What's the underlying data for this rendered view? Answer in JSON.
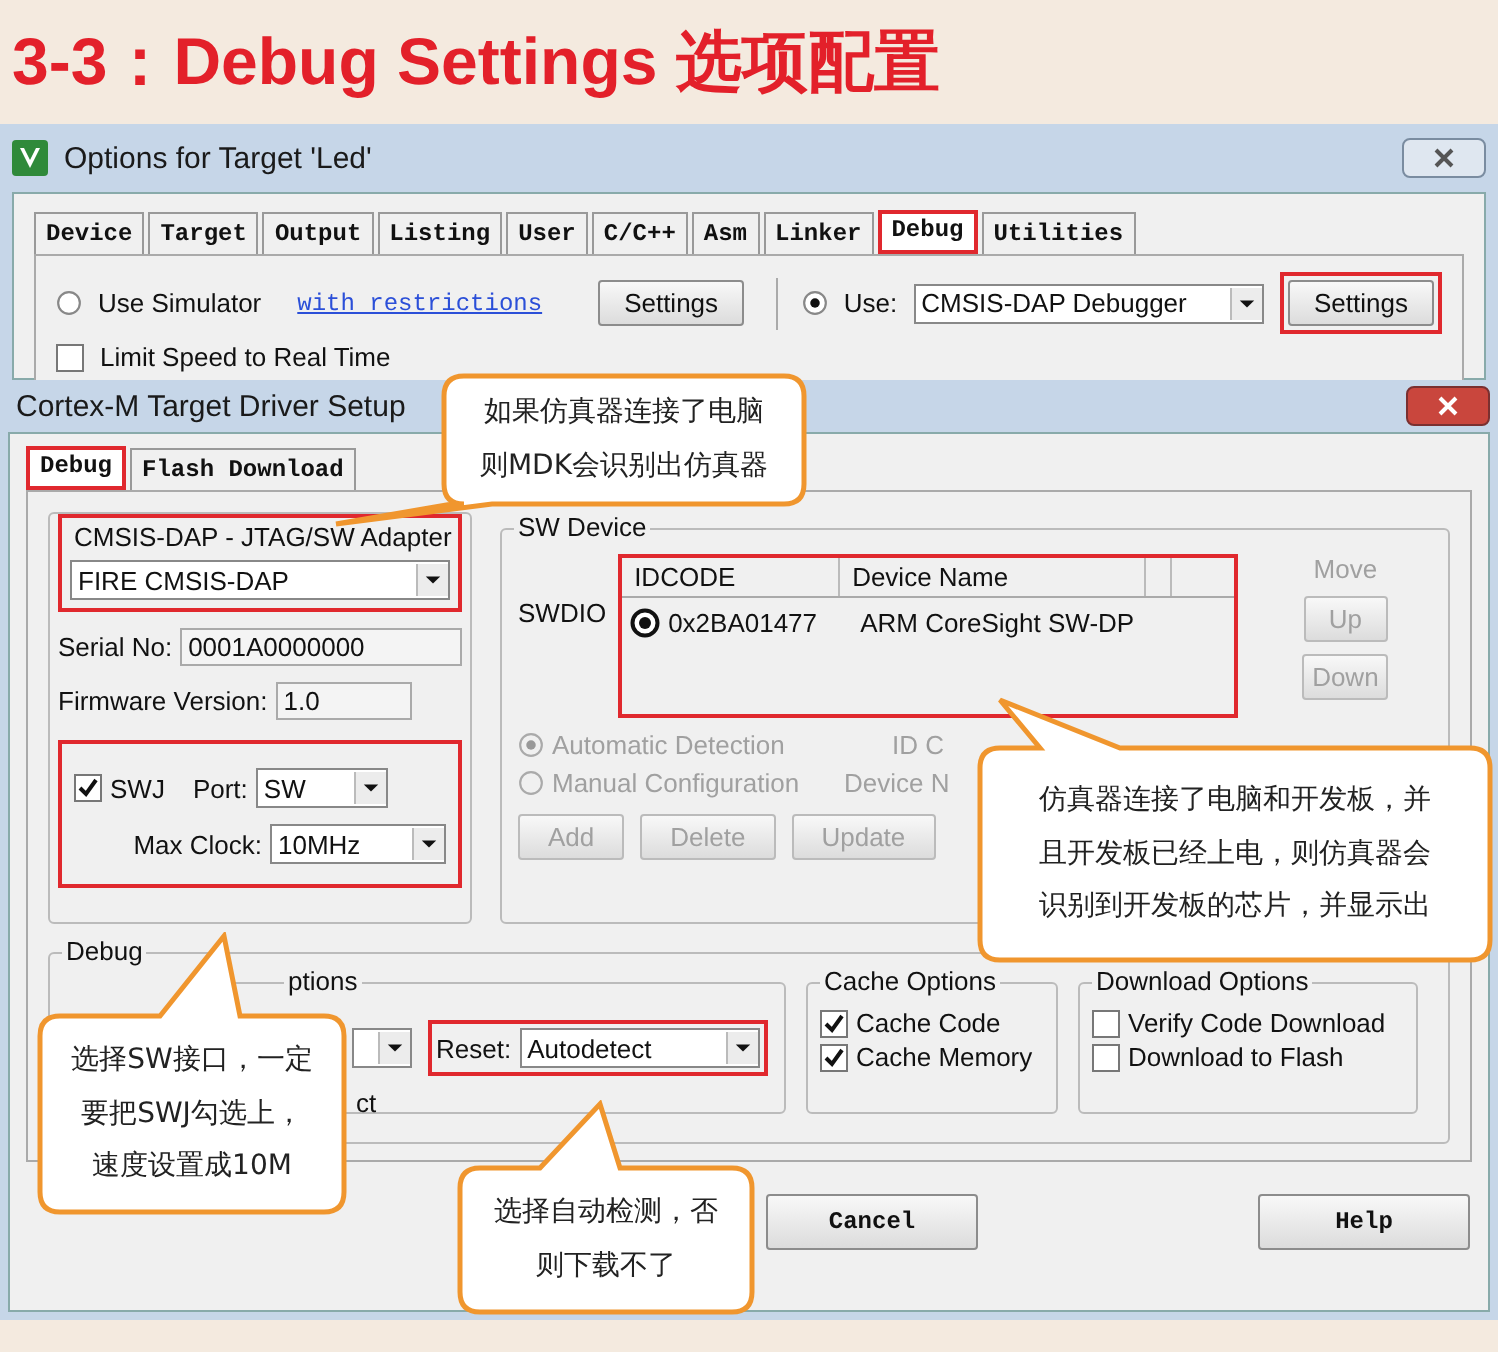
{
  "page_title": "3-3：Debug Settings 选项配置",
  "background_window": {
    "title": "Options for Target 'Led'",
    "tabs": [
      {
        "label": "Device",
        "selected": false,
        "highlighted": false
      },
      {
        "label": "Target",
        "selected": false,
        "highlighted": false
      },
      {
        "label": "Output",
        "selected": false,
        "highlighted": false
      },
      {
        "label": "Listing",
        "selected": false,
        "highlighted": false
      },
      {
        "label": "User",
        "selected": false,
        "highlighted": false
      },
      {
        "label": "C/C++",
        "selected": false,
        "highlighted": false
      },
      {
        "label": "Asm",
        "selected": false,
        "highlighted": false
      },
      {
        "label": "Linker",
        "selected": false,
        "highlighted": false
      },
      {
        "label": "Debug",
        "selected": true,
        "highlighted": true
      },
      {
        "label": "Utilities",
        "selected": false,
        "highlighted": false
      }
    ],
    "simulator": {
      "label": "Use Simulator",
      "selected": false
    },
    "restrictions_link": "with restrictions",
    "simulator_settings": {
      "label": "Settings",
      "highlighted": false
    },
    "use": {
      "label": "Use:",
      "selected": true
    },
    "debugger": "CMSIS-DAP Debugger",
    "debugger_settings": {
      "label": "Settings",
      "highlighted": true
    },
    "limit_speed": {
      "label": "Limit Speed to Real Time",
      "checked": false
    }
  },
  "dialog": {
    "title": "Cortex-M Target Driver Setup",
    "tabs": [
      {
        "label": "Debug",
        "selected": true,
        "highlighted": true
      },
      {
        "label": "Flash Download",
        "selected": false,
        "highlighted": false
      }
    ],
    "adapter": {
      "legend": "CMSIS-DAP - JTAG/SW Adapter",
      "value": "FIRE CMSIS-DAP",
      "highlighted": true,
      "serial_label": "Serial No:",
      "serial": "0001A0000000",
      "firmware_label": "Firmware Version:",
      "firmware": "1.0",
      "swj": {
        "label": "SWJ",
        "checked": true
      },
      "port_label": "Port:",
      "port": "SW",
      "clock_label": "Max Clock:",
      "clock": "10MHz",
      "clock_highlighted": true
    },
    "sw_device": {
      "legend": "SW Device",
      "swdio": "SWDIO",
      "columns": [
        "IDCODE",
        "Device Name"
      ],
      "highlighted": true,
      "rows": [
        {
          "idcode": "0x2BA01477",
          "name": "ARM CoreSight SW-DP",
          "selected": true
        }
      ],
      "move_label": "Move",
      "move_buttons": [
        {
          "label": "Up",
          "disabled": true
        },
        {
          "label": "Down",
          "disabled": true
        }
      ],
      "detection": [
        {
          "label": "Automatic Detection",
          "selected": true,
          "disabled": true
        },
        {
          "label": "Manual Configuration",
          "selected": false,
          "disabled": true
        }
      ],
      "field_labels": [
        "ID C",
        "Device N"
      ],
      "buttons": [
        {
          "label": "Add",
          "disabled": true
        },
        {
          "label": "Delete",
          "disabled": true
        },
        {
          "label": "Update",
          "disabled": true
        }
      ]
    },
    "debug": {
      "legend": "Debug",
      "connect_legend": "ptions",
      "connect_option": "ct",
      "reset_label": "Reset:",
      "reset": "Autodetect",
      "reset_highlighted": true,
      "cache": {
        "legend": "Cache Options",
        "options": [
          {
            "label": "Cache Code",
            "checked": true
          },
          {
            "label": "Cache Memory",
            "checked": true
          }
        ]
      },
      "download": {
        "legend": "Download Options",
        "options": [
          {
            "label": "Verify Code Download",
            "checked": false
          },
          {
            "label": "Download to Flash",
            "checked": false
          }
        ]
      }
    },
    "buttons": [
      {
        "label": "Cancel"
      },
      {
        "label": "Help"
      }
    ]
  },
  "callouts": [
    {
      "lines": [
        "如果仿真器连接了电脑",
        "则MDK会识别出仿真器"
      ]
    },
    {
      "lines": [
        "仿真器连接了电脑和开发板，并",
        "且开发板已经上电，则仿真器会",
        "识别到开发板的芯片，并显示出"
      ]
    },
    {
      "lines": [
        "选择SW接口，一定",
        "要把SWJ勾选上，",
        "速度设置成10M"
      ]
    },
    {
      "lines": [
        "选择自动检测，否",
        "则下载不了"
      ]
    }
  ]
}
